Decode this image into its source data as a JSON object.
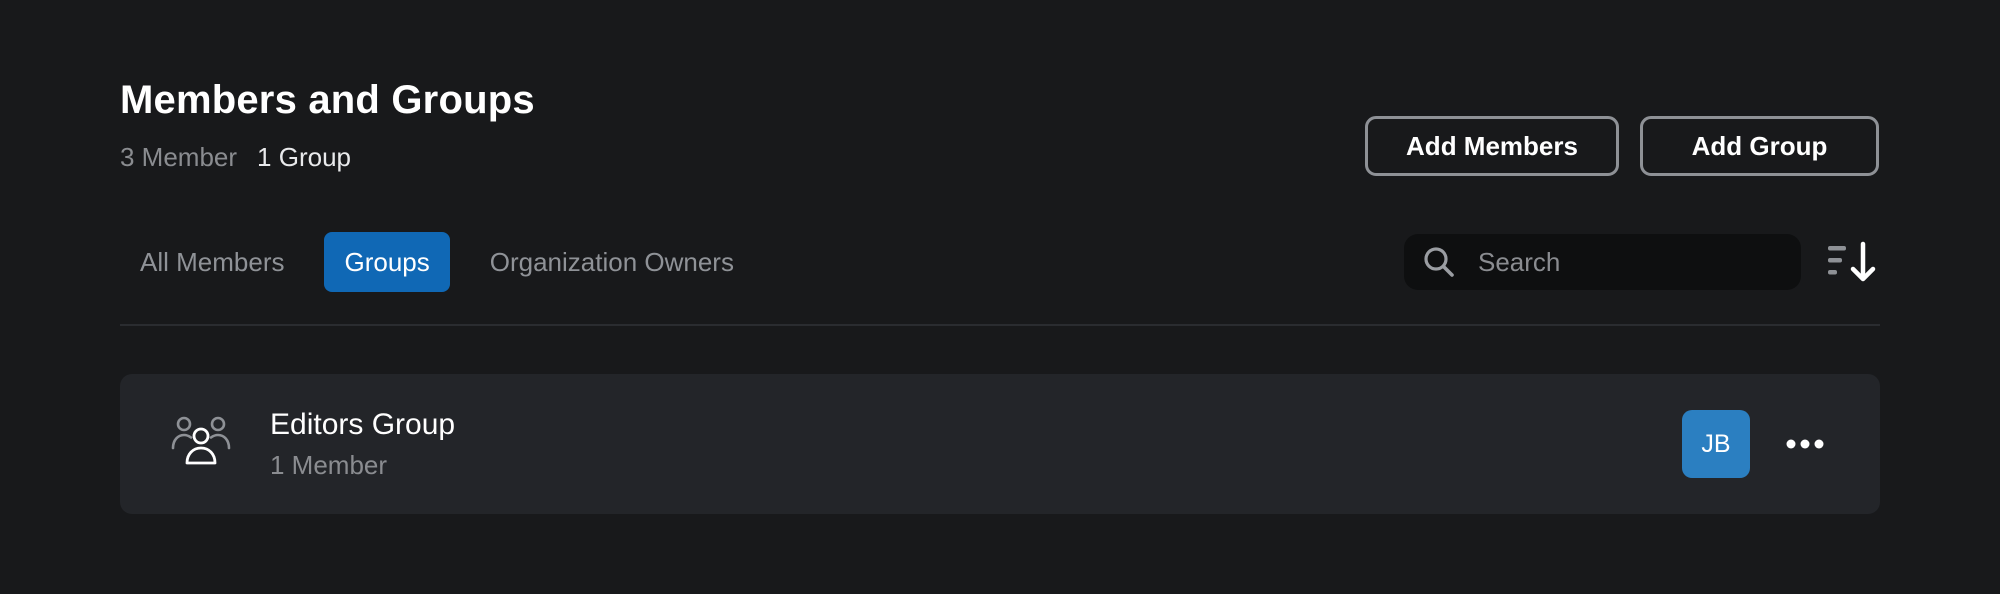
{
  "header": {
    "title": "Members and Groups",
    "member_count": "3 Member",
    "group_count": "1 Group"
  },
  "actions": {
    "add_members_label": "Add Members",
    "add_group_label": "Add Group"
  },
  "tabs": [
    {
      "label": "All Members",
      "active": false
    },
    {
      "label": "Groups",
      "active": true
    },
    {
      "label": "Organization Owners",
      "active": false
    }
  ],
  "search": {
    "placeholder": "Search",
    "value": "",
    "icon": "search-icon"
  },
  "sort": {
    "icon": "sort-descending-icon"
  },
  "groups": [
    {
      "name": "Editors Group",
      "member_count": "1 Member",
      "icon": "group-icon",
      "avatars": [
        "JB"
      ]
    }
  ],
  "colors": {
    "background": "#18191b",
    "card": "#232529",
    "accent": "#1068b5",
    "avatar": "#2b7fc1"
  }
}
